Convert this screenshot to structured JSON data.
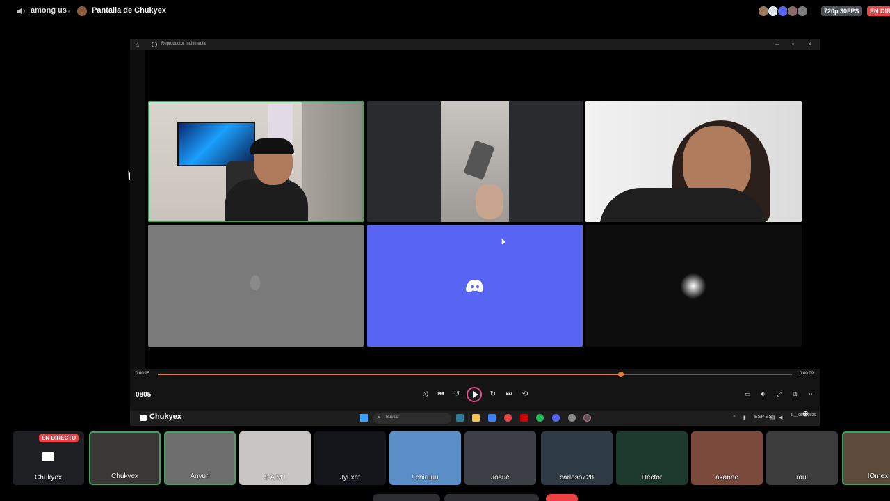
{
  "topbar": {
    "voice_channel": "among us",
    "screen_title": "Pantalla de Chukyex",
    "quality": "720p 30FPS",
    "live": "EN DIRECTO"
  },
  "player": {
    "window_title": "Reproductor multimedia",
    "media_title": "0805",
    "time_elapsed": "0:00:25",
    "time_total": "0:00:09",
    "progress": 0.73
  },
  "taskbar": {
    "stream_label": "Chukyex",
    "search_placeholder": "Buscar",
    "lang": "ESP\nES",
    "clock": "1:__\n08/06/2026"
  },
  "participants": [
    {
      "name": "Chukyex",
      "live": "EN DIRECTO",
      "bg": "#1e1f22",
      "speaking": false
    },
    {
      "name": "Chukyex",
      "bg": "#3a3836",
      "speaking": true
    },
    {
      "name": "Anyuri",
      "bg": "#6e6e6e",
      "speaking": true
    },
    {
      "name": "S A M I",
      "bg": "#c8c6c4",
      "speaking": false
    },
    {
      "name": "Jyuxet",
      "bg": "#14161c",
      "speaking": false
    },
    {
      "name": "! chiruuu",
      "bg": "#5b8ec7",
      "speaking": false
    },
    {
      "name": "Josue",
      "bg": "#3c3f45",
      "speaking": false
    },
    {
      "name": "carloso728",
      "bg": "#2e3b44",
      "speaking": false
    },
    {
      "name": "Hector",
      "bg": "#1e3a2e",
      "speaking": false
    },
    {
      "name": "akanne",
      "bg": "#7a4a3c",
      "speaking": false
    },
    {
      "name": "raul",
      "bg": "#3c3c3c",
      "speaking": false
    },
    {
      "name": "!Omex",
      "bg": "#5c4a3a",
      "speaking": true
    }
  ],
  "colors": {
    "accent_green": "#3ba55d",
    "discord_blurple": "#5865f2",
    "live_red": "#ed4245",
    "seek_orange": "#e07a3c"
  }
}
